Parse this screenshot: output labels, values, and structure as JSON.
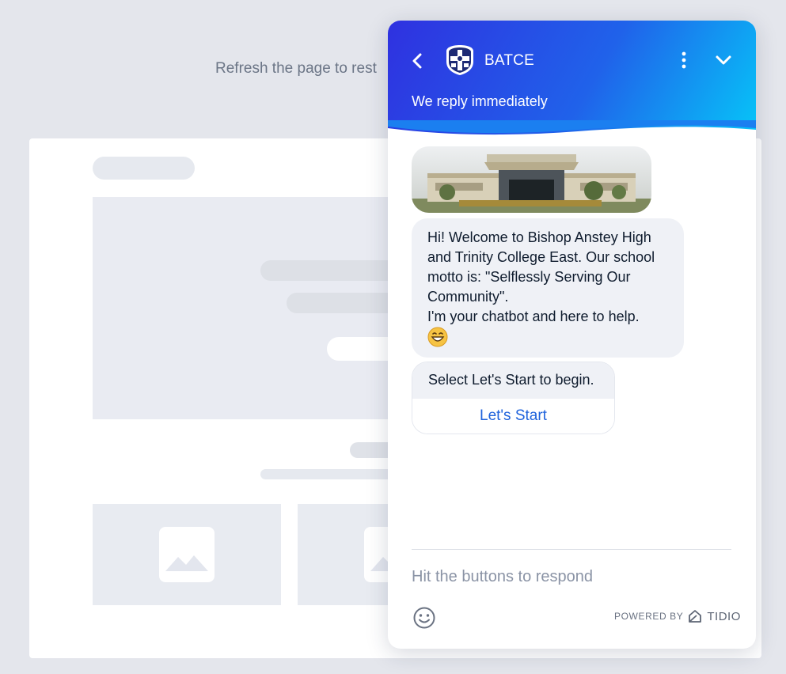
{
  "background": {
    "refresh_text": "Refresh the page to rest"
  },
  "chat": {
    "title": "BATCE",
    "subtitle": "We reply immediately",
    "messages": [
      {
        "type": "text",
        "lines": [
          "Hi! Welcome to Bishop Anstey High",
          "and Trinity College East. Our school",
          "motto is: \"Selflessly Serving Our",
          "Community\".",
          "I'm your chatbot and here to help."
        ]
      },
      {
        "type": "card",
        "text": "Select Let's Start to begin.",
        "button": "Let's Start"
      }
    ],
    "input_placeholder": "Hit the buttons to respond",
    "powered_by": "POWERED BY",
    "brand": "TIDIO"
  },
  "icons": {
    "back": "chevron-left-icon",
    "more": "more-vertical-icon",
    "collapse": "chevron-down-icon",
    "emoji": "smiley-icon",
    "brand_logo": "tidio-logo-icon"
  },
  "colors": {
    "header_start": "#2f31e0",
    "header_end": "#06c6f8",
    "link": "#1f63dc",
    "bubble": "#eff1f6"
  }
}
